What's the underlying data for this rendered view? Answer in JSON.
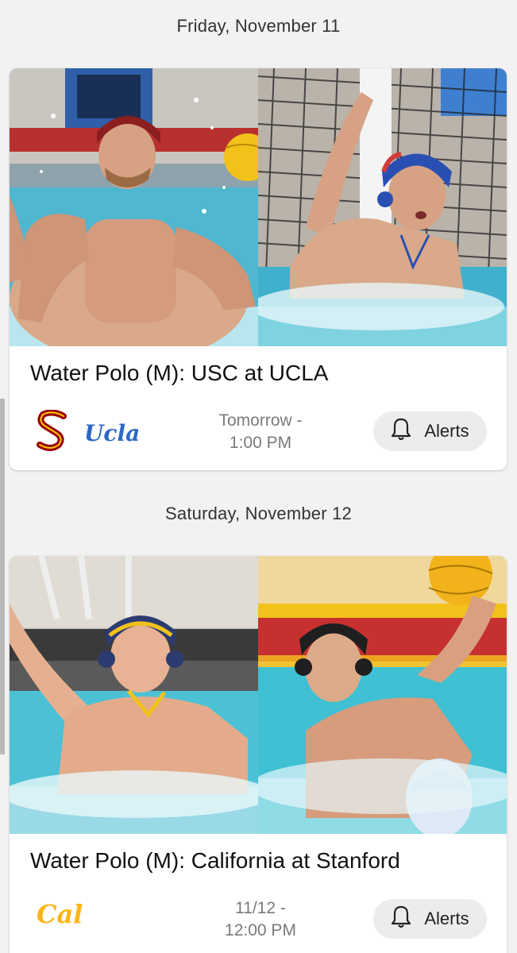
{
  "sections": [
    {
      "date": "Friday, November 11",
      "game": {
        "title": "Water Polo (M): USC at UCLA",
        "time_line1": "Tomorrow -",
        "time_line2": "1:00 PM",
        "alerts_label": "Alerts",
        "teams": [
          "USC",
          "UCLA"
        ]
      }
    },
    {
      "date": "Saturday, November 12",
      "game": {
        "title": "Water Polo (M): California at Stanford",
        "time_line1": "11/12 -",
        "time_line2": "12:00 PM",
        "alerts_label": "Alerts",
        "teams": [
          "California"
        ]
      }
    }
  ],
  "logo_text": {
    "ucla": "Ucla",
    "cal": "Cal"
  },
  "colors": {
    "usc_cardinal": "#990000",
    "usc_gold": "#ffcc00",
    "ucla_blue": "#2d68c4",
    "cal_gold": "#fdb515",
    "pool_water": "#5fc6d6"
  },
  "icons": {
    "alerts": "bell-icon"
  }
}
